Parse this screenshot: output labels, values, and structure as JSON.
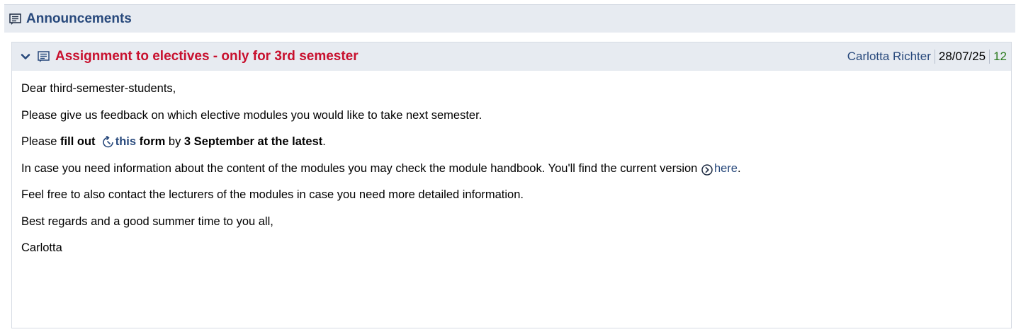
{
  "section": {
    "title": "Announcements",
    "icon": "announcement-icon"
  },
  "announcement": {
    "title": "Assignment to electives - only for 3rd semester",
    "author": "Carlotta Richter",
    "date": "28/07/25",
    "views": "12",
    "expand_icon": "chevron-down-icon",
    "colors": {
      "title": "#c8102e",
      "link": "#28497c",
      "views": "#2b7a1e"
    }
  },
  "body": {
    "greeting": "Dear third-semester-students,",
    "line1": "Please give us feedback on which elective modules you would like to take next semester.",
    "line2": {
      "prefix": "Please ",
      "fill_out": "fill out",
      "link_text": "this",
      "form": "form",
      "by": " by ",
      "deadline": "3 September at the latest",
      "suffix": "."
    },
    "line3": {
      "text": "In case you need information about the content of the modules you may check the module handbook. You'll find the current version",
      "link_text": "here",
      "suffix": "."
    },
    "line4": "Feel free to also contact the lecturers of the modules in case you need more detailed information.",
    "closing": "Best regards and a good summer time to you all,",
    "signature": "Carlotta"
  }
}
